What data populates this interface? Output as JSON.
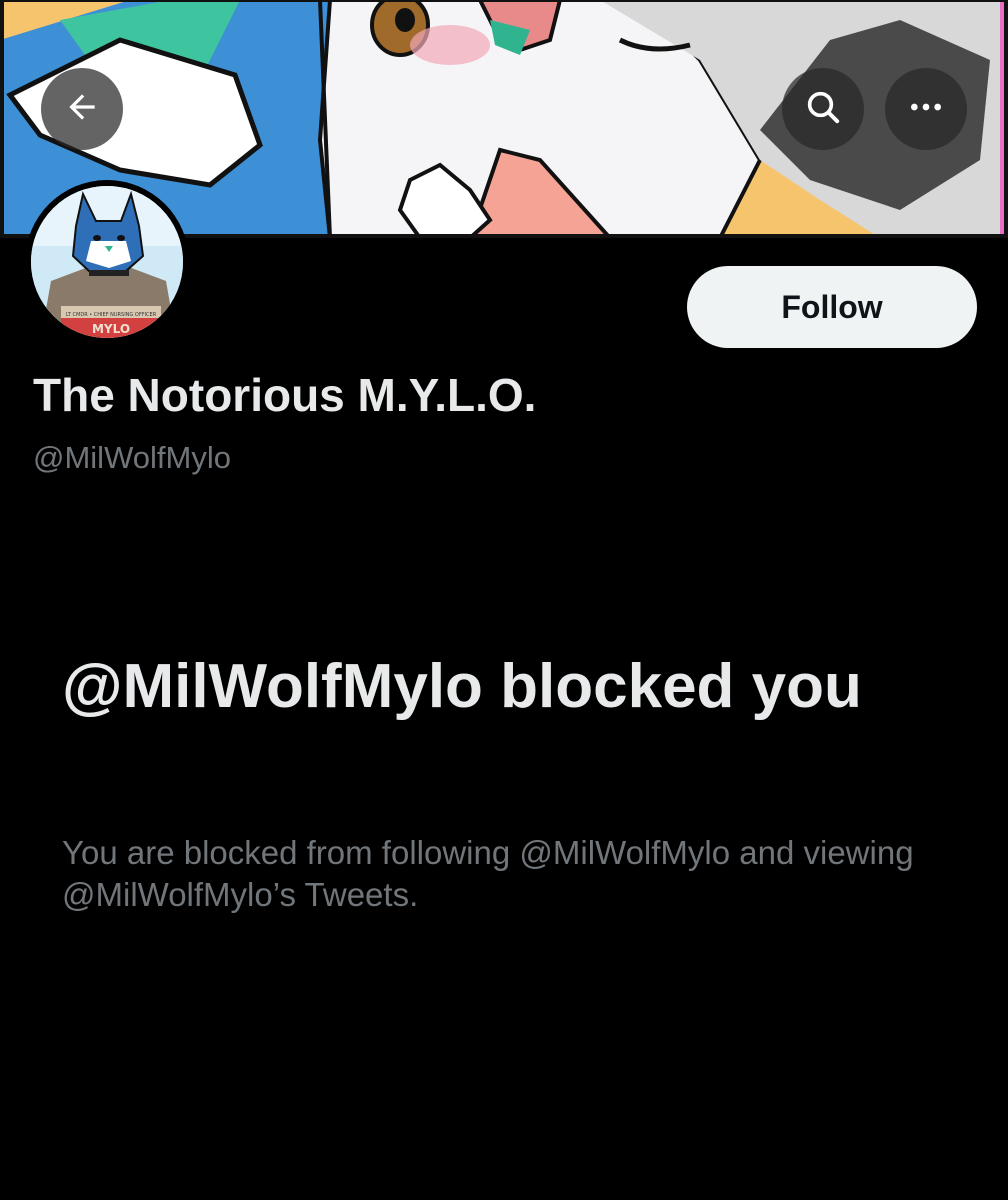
{
  "profile": {
    "display_name": "The Notorious M.Y.L.O.",
    "handle": "@MilWolfMylo",
    "follow_label": "Follow"
  },
  "blocked": {
    "title": "@MilWolfMylo blocked you",
    "description": "You are blocked from following @MilWolfMylo and viewing @MilWolfMylo’s Tweets."
  },
  "icons": {
    "back": "arrow-left-icon",
    "search": "search-icon",
    "more": "more-horizontal-icon"
  },
  "avatar_art": {
    "badge_line": "LT CMDR • CHIEF NURSING OFFICER",
    "badge_name": "MYLO"
  },
  "colors": {
    "background": "#000000",
    "primary_text": "#e7e9ea",
    "secondary_text": "#71767b",
    "follow_button_bg": "#eff3f4",
    "follow_button_text": "#0f1419"
  }
}
